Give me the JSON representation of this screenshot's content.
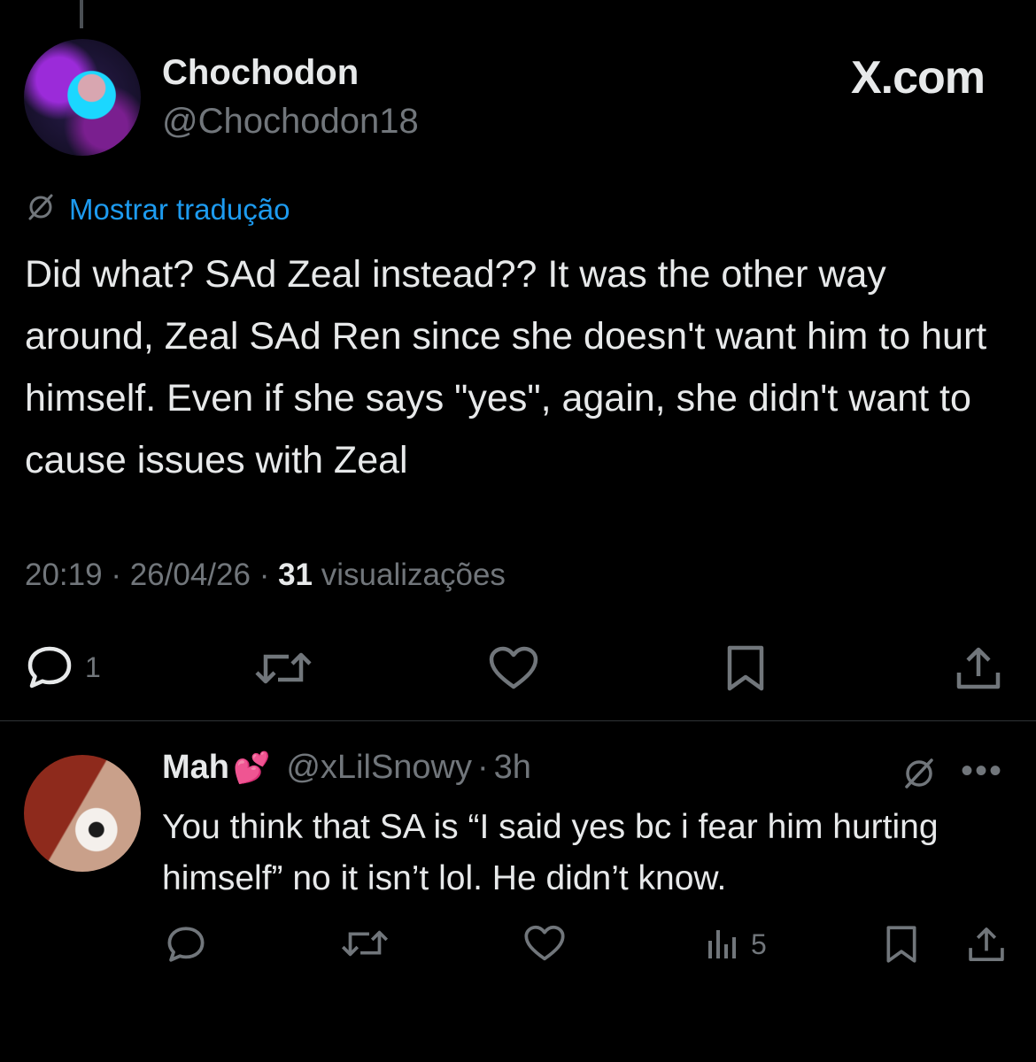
{
  "post": {
    "author_name": "Chochodon",
    "author_handle": "@Chochodon18",
    "site_logo": "X.com",
    "translate_label": "Mostrar tradução",
    "text": "Did what? SAd Zeal instead?? It was the other way around, Zeal SAd Ren since she doesn't want him to hurt himself. Even if she says \"yes\", again, she didn't want to cause issues with Zeal",
    "time": "20:19",
    "date": "26/04/26",
    "separator": "·",
    "views_count": "31",
    "views_label": "visualizações",
    "actions": {
      "reply_icon": "reply-icon",
      "reply_count": "1",
      "repost_icon": "repost-icon",
      "like_icon": "heart-icon",
      "bookmark_icon": "bookmark-icon",
      "share_icon": "share-icon"
    }
  },
  "reply": {
    "author_name": "Mah",
    "author_emoji": "💕",
    "author_handle": "@xLilSnowy",
    "separator": "·",
    "time": "3h",
    "text": "You think that SA is “I said yes bc i fear him hurting himself” no it isn’t lol. He didn’t know.",
    "more_icon": "•••",
    "actions": {
      "views_count": "5"
    }
  },
  "colors": {
    "background": "#000000",
    "text": "#e7e9ea",
    "secondary": "#71767b",
    "accent": "#1d9bf0",
    "divider": "#2f3336"
  }
}
